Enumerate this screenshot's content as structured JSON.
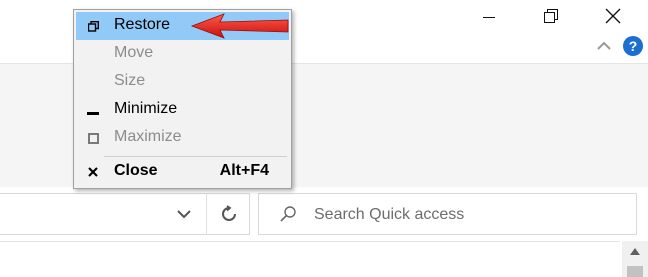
{
  "window": {
    "minimize_icon": "minimize-icon",
    "restore_icon": "restore-window-icon",
    "close_icon": "close-icon",
    "help_label": "?"
  },
  "menu": {
    "items": [
      {
        "label": "Restore",
        "icon": "restore-icon",
        "enabled": true,
        "highlighted": true,
        "accel": ""
      },
      {
        "label": "Move",
        "icon": "",
        "enabled": false,
        "accel": ""
      },
      {
        "label": "Size",
        "icon": "",
        "enabled": false,
        "accel": ""
      },
      {
        "label": "Minimize",
        "icon": "minimize-icon",
        "enabled": true,
        "accel": ""
      },
      {
        "label": "Maximize",
        "icon": "maximize-icon",
        "enabled": false,
        "accel": ""
      },
      {
        "label": "Close",
        "icon": "close-icon",
        "enabled": true,
        "bold": true,
        "accel": "Alt+F4"
      }
    ]
  },
  "search": {
    "placeholder": "Search Quick access"
  },
  "colors": {
    "highlight": "#91c9f7",
    "arrow": "#e21b1b",
    "help": "#1a6fd1"
  }
}
